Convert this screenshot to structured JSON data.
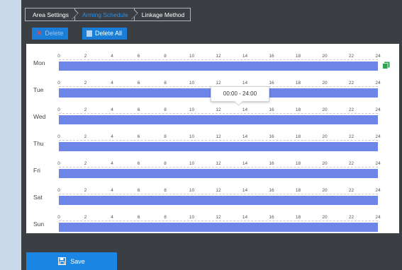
{
  "tabs": [
    "Area Settings",
    "Arming Schedule",
    "Linkage Method"
  ],
  "toolbar": {
    "delete_label": "Delete",
    "delete_all_label": "Delete All"
  },
  "tooltip": "00:00 - 24:00",
  "ticks": [
    "0",
    "2",
    "4",
    "6",
    "8",
    "10",
    "12",
    "14",
    "16",
    "18",
    "20",
    "22",
    "24"
  ],
  "days": [
    "Mon",
    "Tue",
    "Wed",
    "Thu",
    "Fri",
    "Sat",
    "Sun"
  ],
  "schedule_fill": 1.0,
  "colors": {
    "accent": "#1a7ed8",
    "schedule_bar": "#6e85e8",
    "copy_icon": "#2ea44f",
    "delete_icon": "#e34a4a"
  },
  "save_label": "Save",
  "icons": {
    "delete": "x-icon",
    "delete_all": "trash-icon",
    "copy": "copy-icon",
    "save": "floppy-disk-icon"
  }
}
